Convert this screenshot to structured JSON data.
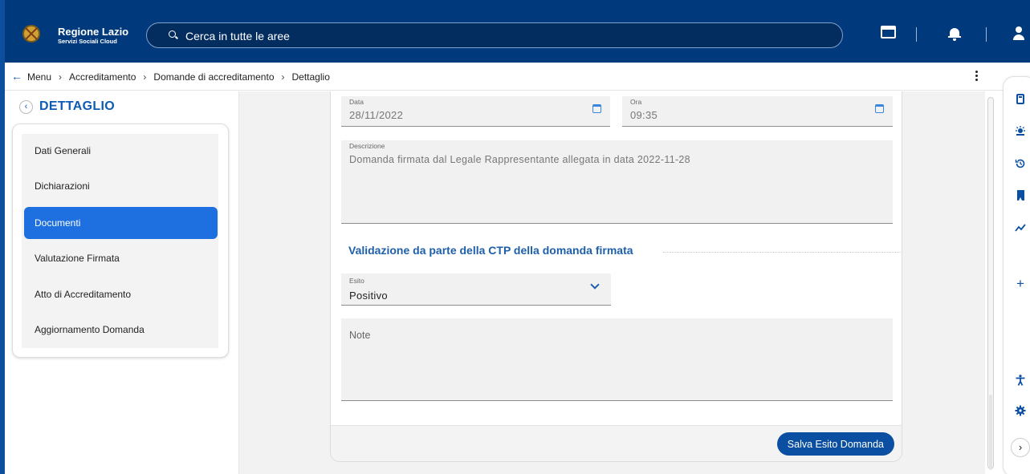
{
  "app": {
    "title": "Regione Lazio",
    "subtitle": "Servizi Sociali Cloud",
    "brand_color": "#003a7d",
    "accent_color": "#1e6fe0"
  },
  "search": {
    "placeholder": "Cerca in tutte le aree"
  },
  "header_icons": [
    "window-icon",
    "bell-icon",
    "user-icon"
  ],
  "breadcrumb": {
    "back_icon": "←",
    "items": [
      "Menu",
      "Accreditamento",
      "Domande di accreditamento",
      "Dettaglio"
    ],
    "separator": "›"
  },
  "sidebar": {
    "back_icon": "‹",
    "title": "DETTAGLIO",
    "items": [
      {
        "label": "Dati Generali",
        "active": false
      },
      {
        "label": "Dichiarazioni",
        "active": false
      },
      {
        "label": "Documenti",
        "active": true
      },
      {
        "label": "Valutazione Firmata",
        "active": false
      },
      {
        "label": "Atto di Accreditamento",
        "active": false
      },
      {
        "label": "Aggiornamento Domanda",
        "active": false
      }
    ]
  },
  "form": {
    "data_label": "Data",
    "data_value": "28/11/2022",
    "ora_label": "Ora",
    "ora_value": "09:35",
    "descrizione_label": "Descrizione",
    "descrizione_value": "Domanda firmata dal Legale Rappresentante allegata in data 2022-11-28",
    "section_title": "Validazione da parte della CTP della domanda firmata",
    "esito_label": "Esito",
    "esito_value": "Positivo",
    "note_placeholder": "Note",
    "save_label": "Salva Esito Domanda"
  },
  "rail": {
    "icons": [
      "calculator-icon",
      "weather-icon",
      "history-icon",
      "bookmark-icon",
      "trend-icon",
      "plus-icon",
      "accessibility-icon",
      "settings-icon"
    ],
    "plus": "+",
    "next": "›"
  }
}
